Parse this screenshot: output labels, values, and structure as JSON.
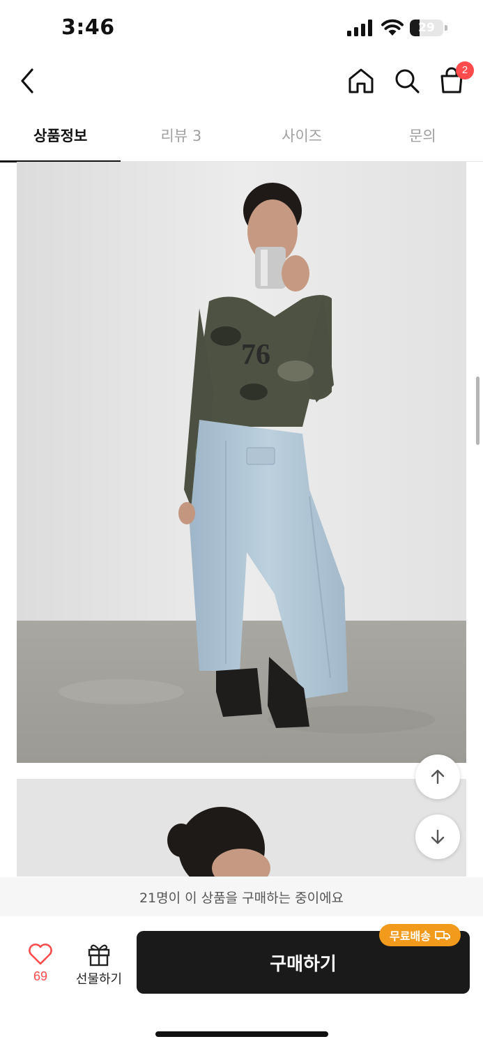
{
  "status_bar": {
    "time": "3:46",
    "battery_level": "29",
    "battery_fraction": 0.29
  },
  "nav": {
    "back_icon": "chevron-left-icon",
    "home_icon": "home-icon",
    "search_icon": "search-icon",
    "cart_icon": "shopping-bag-icon",
    "cart_badge": "2"
  },
  "tabs": [
    {
      "label": "상품정보",
      "active": true
    },
    {
      "label": "리뷰 3",
      "active": false
    },
    {
      "label": "사이즈",
      "active": false
    },
    {
      "label": "문의",
      "active": false
    }
  ],
  "floating": {
    "up_icon": "arrow-up-icon",
    "down_icon": "arrow-down-icon"
  },
  "buyers_banner": "21명이 이 상품을 구매하는 중이에요",
  "bottom_bar": {
    "like_icon": "heart-icon",
    "like_count": "69",
    "gift_icon": "gift-icon",
    "gift_label": "선물하기",
    "buy_label": "구매하기",
    "free_shipping_badge": "무료배송",
    "truck_icon": "truck-icon"
  },
  "colors": {
    "accent_red": "#ff4b4b",
    "buy_button": "#1a1a1a",
    "badge_orange": "#f29a1b"
  }
}
